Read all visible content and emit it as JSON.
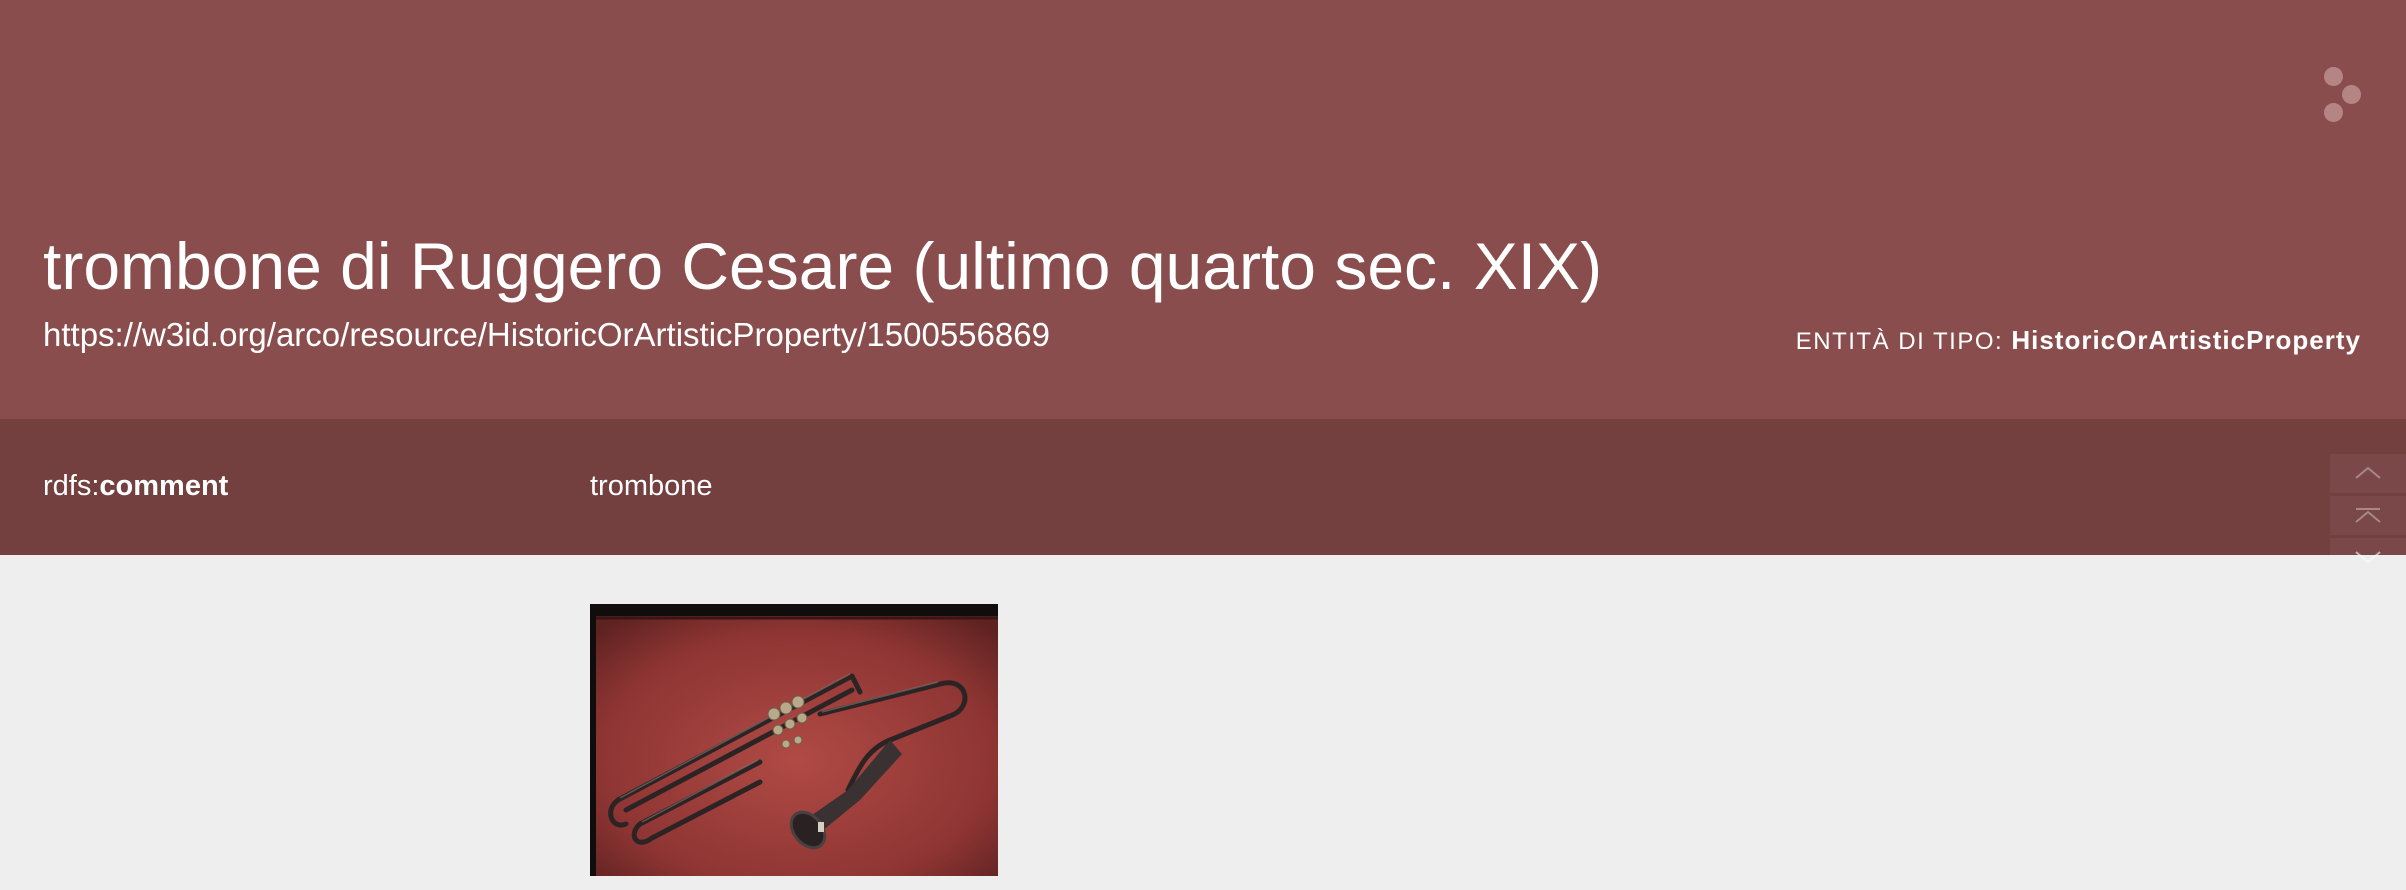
{
  "header": {
    "title": "trombone di Ruggero Cesare (ultimo quarto sec. XIX)",
    "uri": "https://w3id.org/arco/resource/HistoricOrArtisticProperty/1500556869",
    "entity_type_prefix": "ENTITÀ DI TIPO:",
    "entity_type_name": "HistoricOrArtisticProperty"
  },
  "property": {
    "prefix": "rdfs:",
    "name": "comment",
    "value": "trombone"
  },
  "icons": {
    "logo": "three-dots-logo-icon",
    "scroll_up": "chevron-up-icon",
    "scroll_top": "scroll-to-top-icon",
    "scroll_down": "chevron-down-icon"
  },
  "colors": {
    "header_bg": "#8a4d4d",
    "property_row_bg": "#733f3f",
    "page_bg": "#eeeeee"
  }
}
